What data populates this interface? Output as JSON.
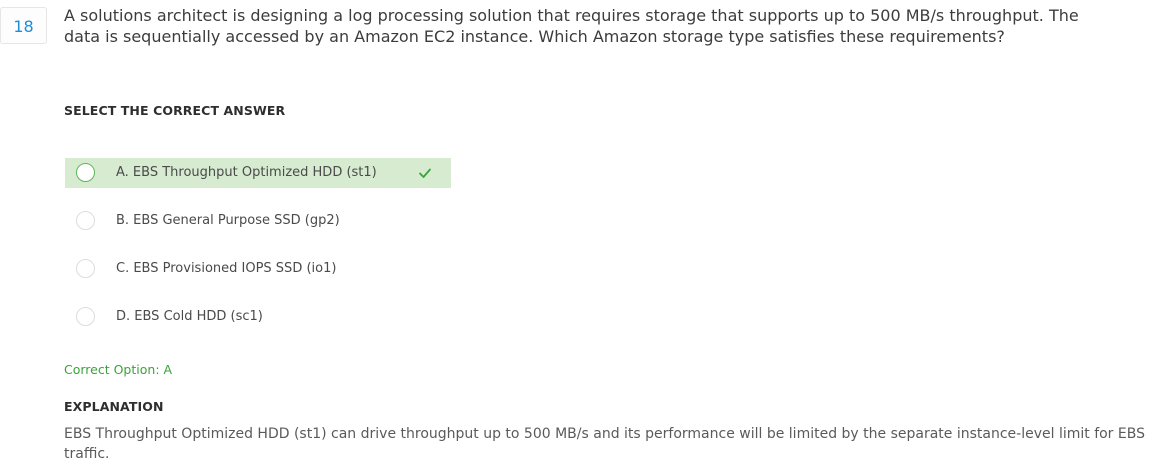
{
  "question": {
    "number": "18",
    "line1": "A solutions architect is designing a log processing solution that requires storage that supports up to 500 MB/s throughput. The",
    "line2": "data is sequentially accessed by an Amazon EC2 instance. Which Amazon storage type satisfies these requirements?"
  },
  "select_heading": "SELECT THE CORRECT ANSWER",
  "options": [
    {
      "label": "A. EBS Throughput Optimized HDD (st1)",
      "selected": true,
      "correct": true
    },
    {
      "label": "B. EBS General Purpose SSD (gp2)",
      "selected": false,
      "correct": false
    },
    {
      "label": "C. EBS Provisioned IOPS SSD (io1)",
      "selected": false,
      "correct": false
    },
    {
      "label": "D. EBS Cold HDD (sc1)",
      "selected": false,
      "correct": false
    }
  ],
  "correct_option_text": "Correct Option: A",
  "explanation_heading": "EXPLANATION",
  "explanation_text": "EBS Throughput Optimized HDD (st1) can drive throughput up to 500 MB/s and its performance will be limited by the separate instance-level limit for EBS traffic.",
  "colors": {
    "accent_blue": "#1f8cd8",
    "correct_green": "#3aa33a",
    "selected_bg": "#d7ebd1"
  },
  "icons": {
    "correct_marker": "check-icon"
  }
}
